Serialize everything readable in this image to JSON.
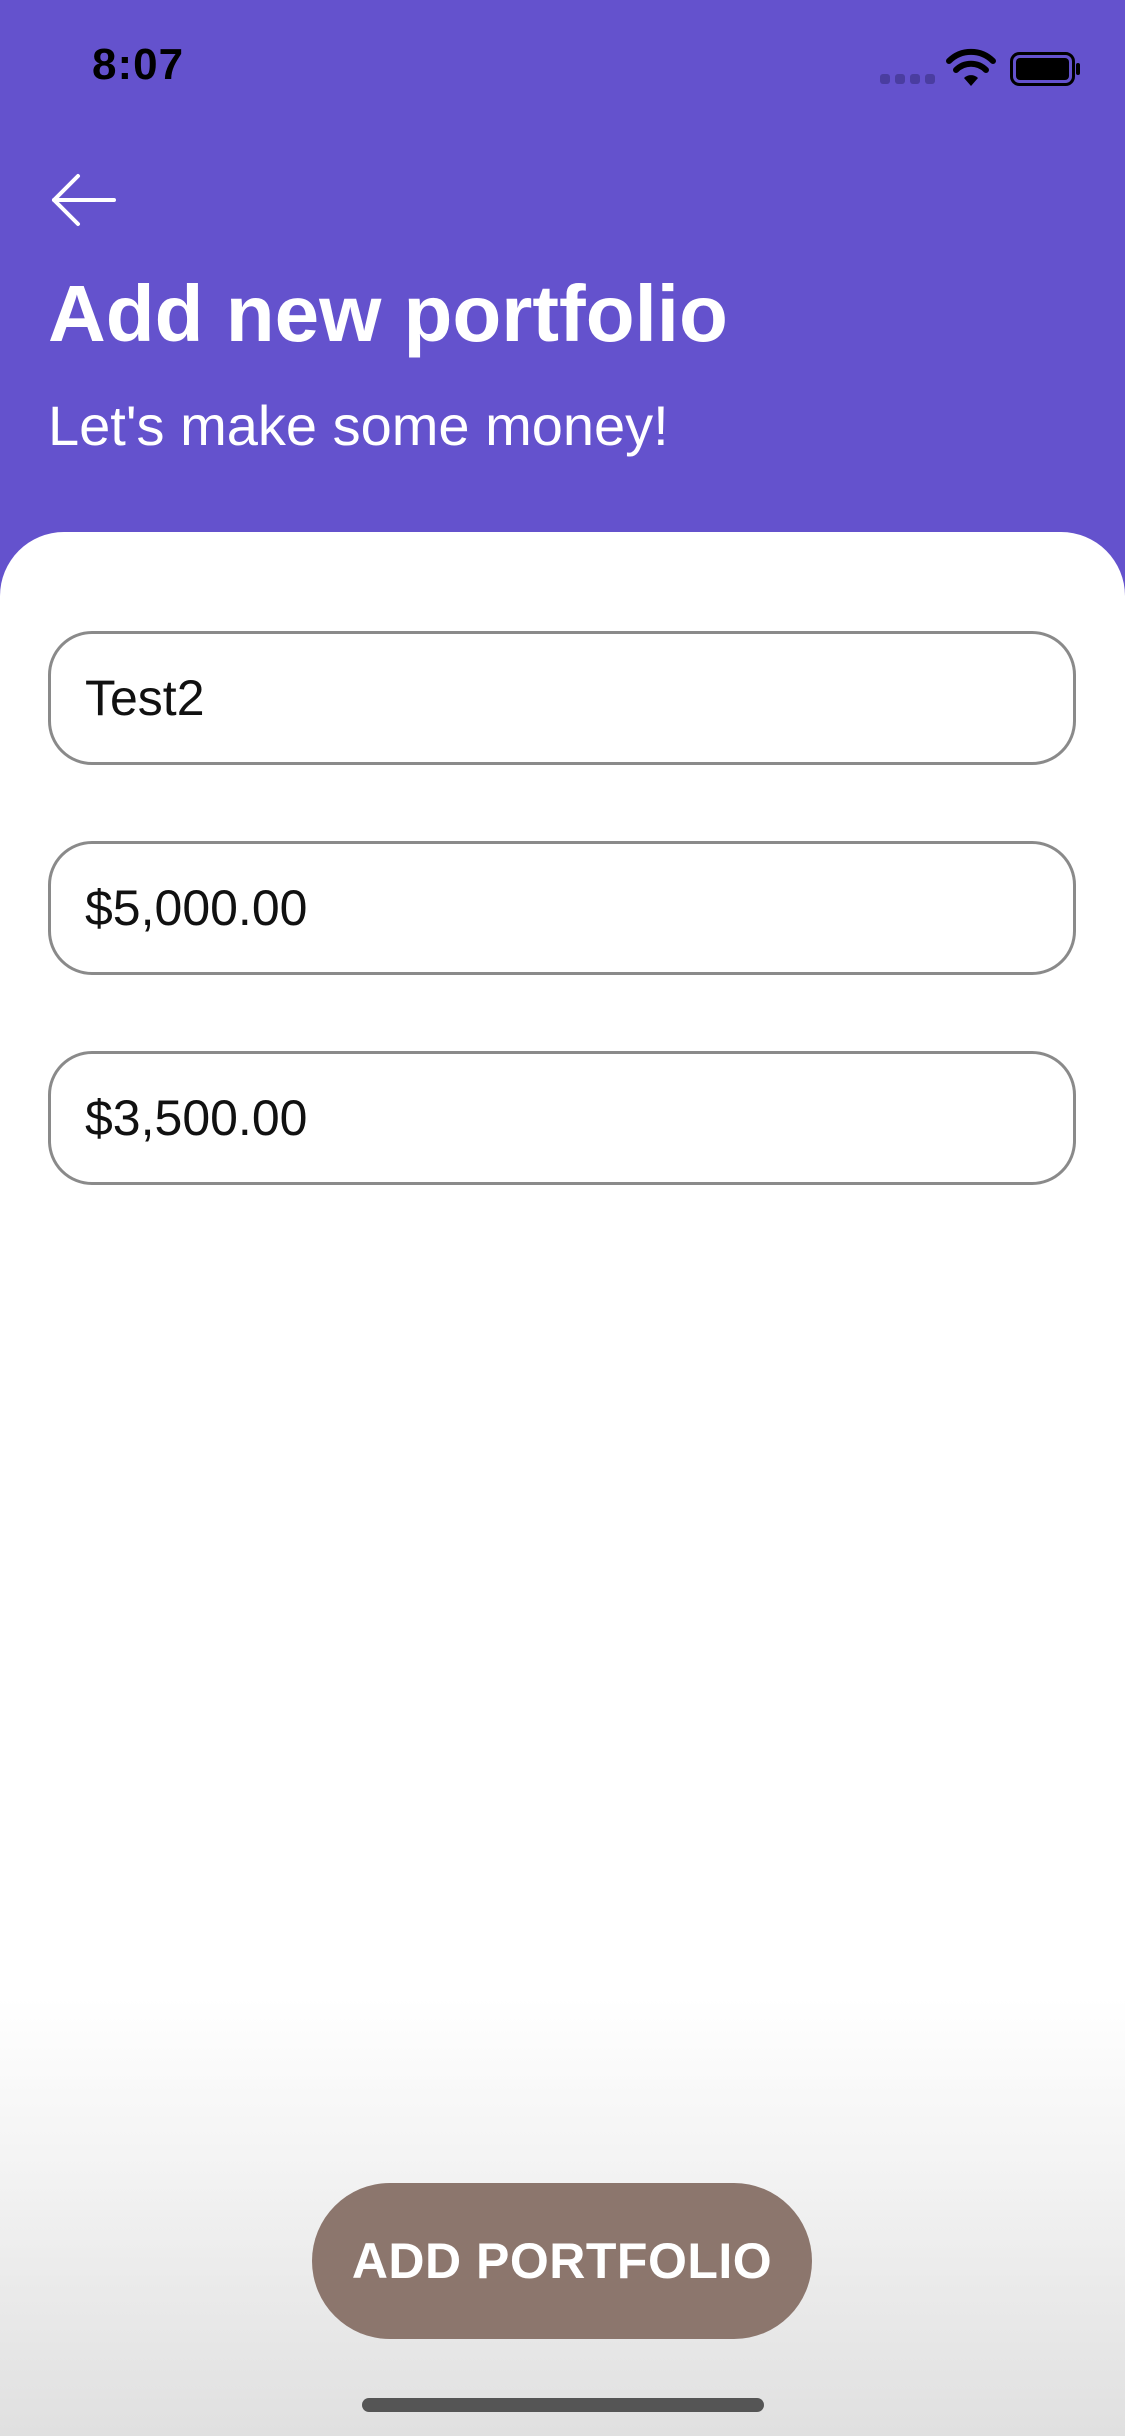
{
  "status_bar": {
    "time": "8:07"
  },
  "header": {
    "back_icon": "arrow-left-icon",
    "title": "Add new portfolio",
    "subtitle": "Let's make some money!"
  },
  "form": {
    "name_value": "Test2",
    "amount1_value": "$5,000.00",
    "amount2_value": "$3,500.00"
  },
  "actions": {
    "submit_label": "ADD PORTFOLIO"
  },
  "colors": {
    "header_bg": "#6452CD",
    "button_bg": "#8C766D",
    "text_on_header": "#FFFFFF",
    "field_border": "#8A8A8A"
  }
}
